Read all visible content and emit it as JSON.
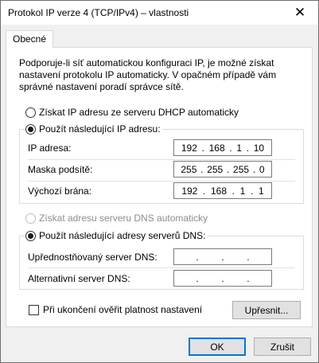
{
  "window": {
    "title": "Protokol IP verze 4 (TCP/IPv4) – vlastnosti",
    "close_glyph": "✕"
  },
  "tabs": [
    {
      "label": "Obecné"
    }
  ],
  "description": "Podporuje-li síť automatickou konfiguraci IP, je možné získat nastavení protokolu IP automaticky. V opačném případě vám správné nastavení poradí správce sítě.",
  "ip_section": {
    "auto_label": "Získat IP adresu ze serveru DHCP automaticky",
    "manual_label": "Použít následující IP adresu:",
    "selected": "manual",
    "fields": [
      {
        "label": "IP adresa:",
        "octets": [
          "192",
          "168",
          "1",
          "10"
        ]
      },
      {
        "label": "Maska podsítě:",
        "octets": [
          "255",
          "255",
          "255",
          "0"
        ]
      },
      {
        "label": "Výchozí brána:",
        "octets": [
          "192",
          "168",
          "1",
          "1"
        ]
      }
    ]
  },
  "dns_section": {
    "auto_label": "Získat adresu serveru DNS automaticky",
    "auto_disabled": true,
    "manual_label": "Použít následující adresy serverů DNS:",
    "selected": "manual",
    "fields": [
      {
        "label": "Upřednostňovaný server DNS:",
        "octets": [
          "",
          "",
          "",
          ""
        ]
      },
      {
        "label": "Alternativní server DNS:",
        "octets": [
          "",
          "",
          "",
          ""
        ]
      }
    ]
  },
  "validate_on_exit": {
    "label": "Při ukončení ověřit platnost nastavení",
    "checked": false
  },
  "buttons": {
    "advanced": "Upřesnit...",
    "ok": "OK",
    "cancel": "Zrušit"
  },
  "ip_dot": "."
}
